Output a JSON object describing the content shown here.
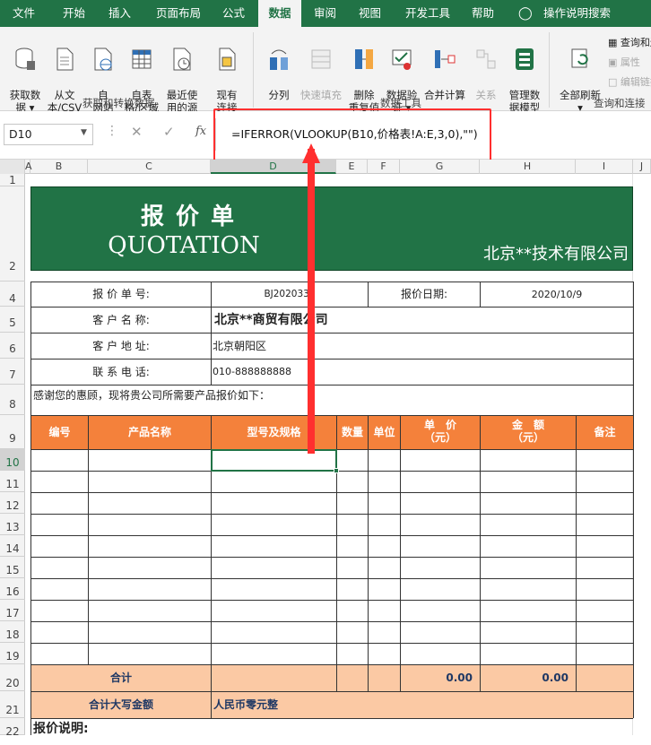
{
  "menu": {
    "items": [
      "文件",
      "开始",
      "插入",
      "页面布局",
      "公式",
      "数据",
      "审阅",
      "视图",
      "开发工具",
      "帮助"
    ],
    "active": "数据",
    "tell_me": "操作说明搜索"
  },
  "ribbon": {
    "get_transform": {
      "buttons": [
        "获取数\n据 ▾",
        "从文\n本/CSV",
        "自\n网站",
        "自表\n格/区域",
        "最近使\n用的源",
        "现有\n连接"
      ],
      "label": "获取和转换数据"
    },
    "data_tools": {
      "buttons": [
        "分列",
        "快速填充",
        "删除\n重复值",
        "数据验\n证 ▾",
        "合并计算",
        "关系",
        "管理数\n据模型"
      ],
      "label": "数据工具"
    },
    "query_conn": {
      "refresh": "全部刷新\n▾",
      "side": [
        "查询和连接",
        "属性",
        "编辑链接"
      ],
      "label": "查询和连接"
    }
  },
  "formula_bar": {
    "name_box": "D10",
    "formula": "=IFERROR(VLOOKUP(B10,价格表!A:E,3,0),\"\")",
    "fx": "fx"
  },
  "columns": [
    "A",
    "B",
    "C",
    "D",
    "E",
    "F",
    "G",
    "H",
    "I",
    "J"
  ],
  "rows": [
    "1",
    "2",
    "4",
    "5",
    "6",
    "7",
    "8",
    "9",
    "10",
    "11",
    "12",
    "13",
    "14",
    "15",
    "16",
    "17",
    "18",
    "19",
    "20",
    "21",
    "22"
  ],
  "sheet": {
    "title_cn": "报 价 单",
    "title_en": "QUOTATION",
    "company": "北京**技术有限公司",
    "quote_no_label": "报 价 单 号:",
    "quote_no": "BJ2020333",
    "date_label": "报价日期:",
    "date": "2020/10/9",
    "client_label": "客 户 名 称:",
    "client": "北京**商贸有限公司",
    "address_label": "客 户 地 址:",
    "address": "北京朝阳区",
    "phone_label": "联 系 电 话:",
    "phone": "010-888888888",
    "intro": "感谢您的惠顾，现将贵公司所需要产品报价如下：",
    "headers": [
      "编号",
      "产品名称",
      "型号及规格",
      "数量",
      "单位",
      "单　价\n（元）",
      "金　额\n（元）",
      "备注"
    ],
    "total_label": "合计",
    "total_price": "0.00",
    "total_amount": "0.00",
    "total_caps_label": "合计大写金额",
    "total_caps": "人民币零元整",
    "notes_label": "报价说明:"
  },
  "colors": {
    "excel_green": "#217346",
    "header_orange": "#f4813b",
    "sum_peach": "#fbc9a4",
    "highlight_red": "#ff2f2f"
  }
}
